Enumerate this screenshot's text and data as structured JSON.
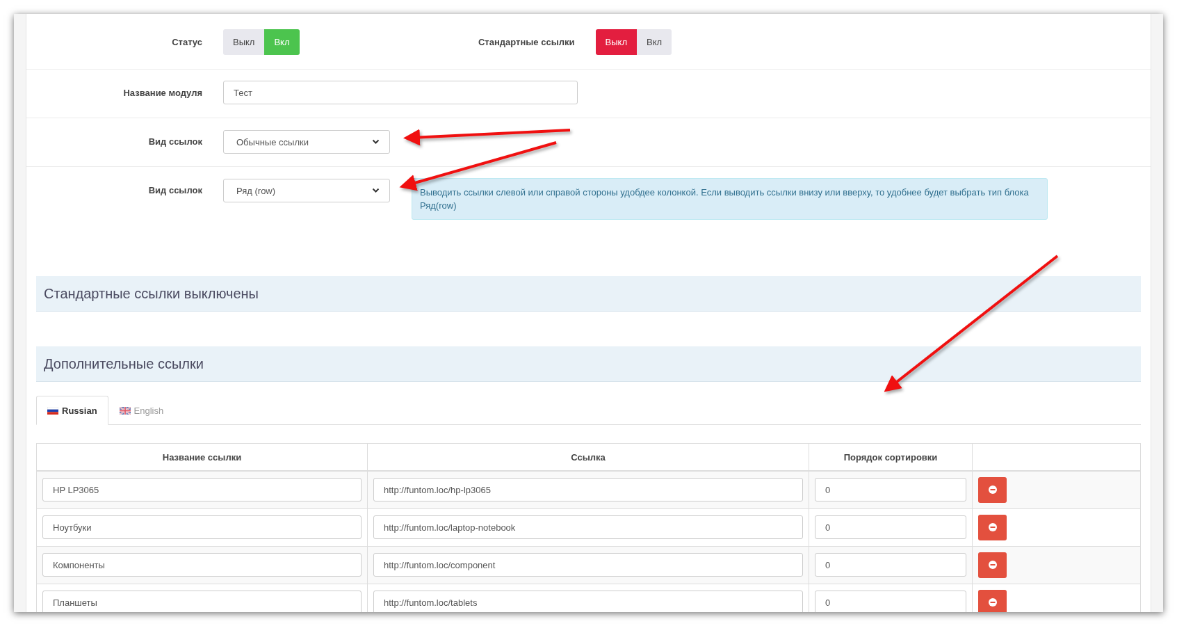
{
  "settings": [
    {
      "kind": "toggles",
      "items": [
        {
          "label": "Статус",
          "options": [
            {
              "label": "Выкл",
              "selected": false
            },
            {
              "label": "Вкл",
              "selected": true
            }
          ]
        },
        {
          "label": "Стандартные ссылки",
          "options": [
            {
              "label": "Выкл",
              "selected": true
            },
            {
              "label": "Вкл",
              "selected": false
            }
          ]
        }
      ]
    },
    {
      "kind": "text",
      "label": "Название модуля",
      "value": "Тест"
    },
    {
      "kind": "select",
      "label": "Вид ссылок",
      "value": "Обычные ссылки"
    },
    {
      "kind": "select",
      "label": "Вид ссылок",
      "value": "Ряд (row)",
      "hint": "Выводить ссылки слевой или справой стороны удобдее колонкой. Если выводить ссылки внизу или вверху, то удобнее будет выбрать тип блока Ряд(row)"
    }
  ],
  "sections": [
    {
      "title": "Стандартные ссылки выключены"
    },
    {
      "title": "Дополнительные ссылки"
    }
  ],
  "tabs": [
    {
      "label": "Russian",
      "selected": true
    },
    {
      "label": "English",
      "selected": false
    }
  ],
  "table": {
    "columns": [
      "Название ссылки",
      "Ссылка",
      "Порядок сортировки"
    ],
    "rows": [
      {
        "name": "HP LP3065",
        "link": "http://funtom.loc/hp-lp3065",
        "sort": "0"
      },
      {
        "name": "Ноутбуки",
        "link": "http://funtom.loc/laptop-notebook",
        "sort": "0"
      },
      {
        "name": "Компоненты",
        "link": "http://funtom.loc/component",
        "sort": "0"
      },
      {
        "name": "Планшеты",
        "link": "http://funtom.loc/tablets",
        "sort": "0"
      }
    ]
  }
}
